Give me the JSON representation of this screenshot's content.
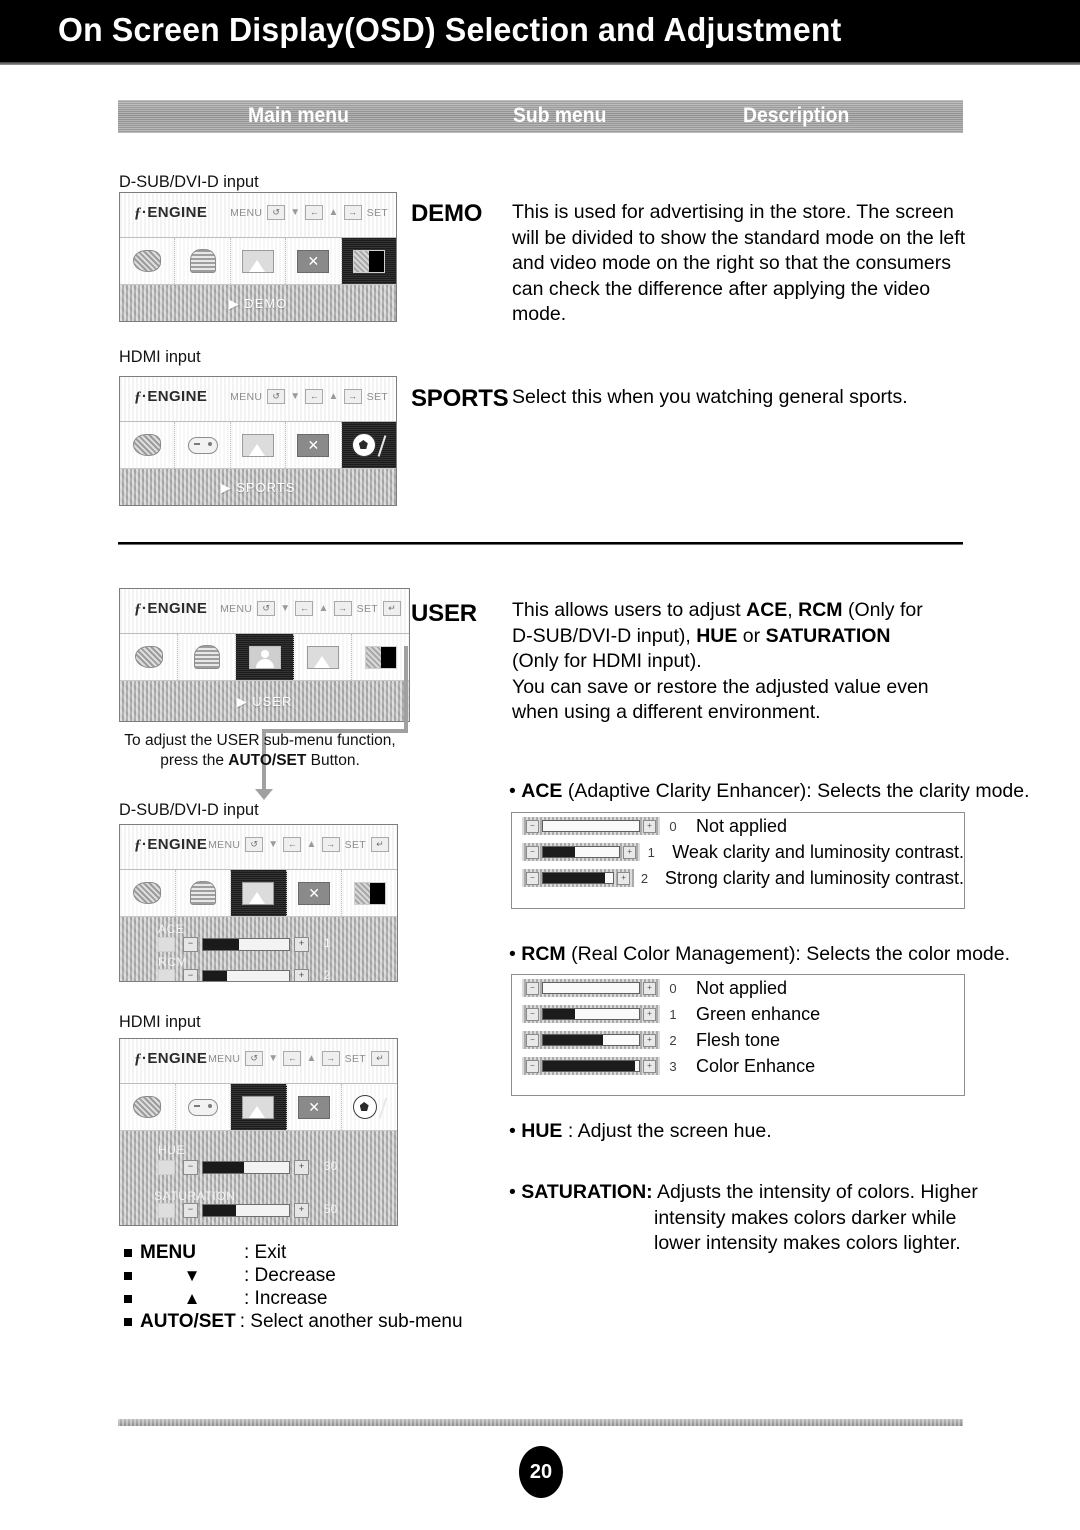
{
  "header": {
    "title": "On Screen Display(OSD) Selection and Adjustment"
  },
  "table_header": {
    "main": "Main menu",
    "sub": "Sub menu",
    "description": "Description"
  },
  "osd_common": {
    "brand": "ENGINE",
    "brand_mark": "f",
    "menu_label": "MENU",
    "set_label": "SET",
    "icons": {
      "palette": "palette-icon",
      "globe": "internet-icon",
      "picture": "picture-icon",
      "normal": "normal-x-icon",
      "demo": "demo-split-icon",
      "gamepad": "game-icon",
      "soccer": "sports-icon",
      "user": "user-icon"
    }
  },
  "sections": {
    "demo": {
      "input_label": "D-SUB/DVI-D input",
      "osd_selected_label": "DEMO",
      "submenu": "DEMO",
      "description": "This is used for advertising in the store. The screen will be divided to show the standard mode on the left and video mode on the right so that the consumers can check the difference after applying the video mode."
    },
    "sports": {
      "input_label": "HDMI input",
      "osd_selected_label": "SPORTS",
      "submenu": "SPORTS",
      "description": "Select this when you watching general sports."
    },
    "user": {
      "osd_selected_label": "USER",
      "submenu": "USER",
      "desc_line1_a": "This allows users to adjust ",
      "desc_line1_b": "ACE",
      "desc_line1_c": ", ",
      "desc_line1_d": "RCM",
      "desc_line1_e": " (Only for",
      "desc_line2_a": "D-SUB/DVI-D input), ",
      "desc_line2_b": "HUE",
      "desc_line2_c": " or ",
      "desc_line2_d": "SATURATION",
      "desc_line3": "(Only for HDMI input).",
      "desc_line4": "You can save or restore the adjusted value even",
      "desc_line5": "when using a different environment.",
      "note_line1": "To adjust the USER sub-menu function,",
      "note_line2_a": "press the ",
      "note_line2_b": "AUTO/SET",
      "note_line2_c": " Button."
    },
    "dsub_panel": {
      "input_label": "D-SUB/DVI-D input",
      "rows": [
        {
          "label": "ACE",
          "value": "1",
          "fill_pct": 42
        },
        {
          "label": "RCM",
          "value": "2",
          "fill_pct": 28
        }
      ]
    },
    "hdmi_panel": {
      "input_label": "HDMI input",
      "rows": [
        {
          "label": "HUE",
          "value": "30",
          "fill_pct": 48
        },
        {
          "label": "SATURATION",
          "value": "50",
          "fill_pct": 38
        }
      ]
    }
  },
  "ace": {
    "bullet_a": "• ",
    "bullet_b": "ACE",
    "bullet_c": " (Adaptive Clarity Enhancer): Selects the clarity mode.",
    "rows": [
      {
        "num": "0",
        "fill_pct": 0,
        "text": "Not applied"
      },
      {
        "num": "1",
        "fill_pct": 42,
        "text": "Weak clarity and luminosity contrast."
      },
      {
        "num": "2",
        "fill_pct": 88,
        "text": "Strong clarity and luminosity contrast."
      }
    ]
  },
  "rcm": {
    "bullet_a": "• ",
    "bullet_b": "RCM",
    "bullet_c": " (Real Color Management): Selects the color mode.",
    "rows": [
      {
        "num": "0",
        "fill_pct": 0,
        "text": "Not applied"
      },
      {
        "num": "1",
        "fill_pct": 33,
        "text": "Green enhance"
      },
      {
        "num": "2",
        "fill_pct": 62,
        "text": "Flesh tone"
      },
      {
        "num": "3",
        "fill_pct": 96,
        "text": "Color Enhance"
      }
    ]
  },
  "hue": {
    "bullet_a": "• ",
    "bullet_b": "HUE",
    "bullet_c": " : Adjust the screen hue."
  },
  "saturation": {
    "bullet_a": "• ",
    "bullet_b": "SATURATION:",
    "line1": " Adjusts the intensity of colors. Higher",
    "line2": "intensity makes colors darker while",
    "line3": "lower intensity makes colors lighter."
  },
  "legend": [
    {
      "key": "MENU",
      "bold": true,
      "sep": ": Exit"
    },
    {
      "key": "▼",
      "bold": true,
      "sep": ": Decrease"
    },
    {
      "key": "▲",
      "bold": true,
      "sep": ": Increase"
    },
    {
      "key": "AUTO/SET",
      "bold": true,
      "sep": ": Select another sub-menu"
    }
  ],
  "footer": {
    "page_number": "20"
  },
  "colors": {
    "header_bg": "#000000",
    "header_text": "#ffffff",
    "strip": "#8f8f8f"
  }
}
